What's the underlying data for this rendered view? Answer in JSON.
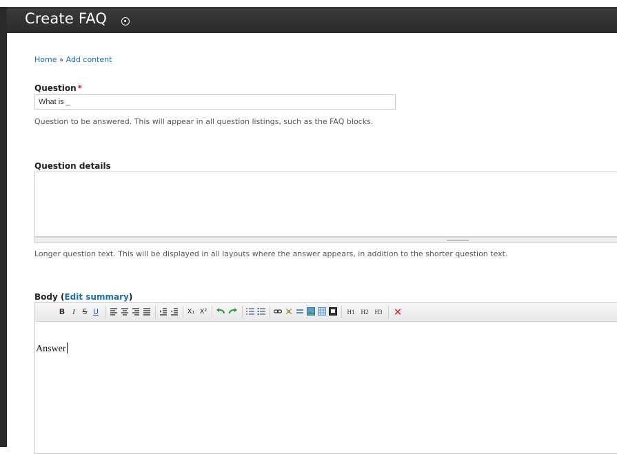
{
  "header": {
    "title": "Create FAQ",
    "icon": "circle-plus-icon"
  },
  "breadcrumb": {
    "home": "Home",
    "separator": "»",
    "current": "Add content"
  },
  "question": {
    "label": "Question",
    "required_mark": "*",
    "value": "What is _",
    "description": "Question to be answered. This will appear in all question listings, such as the FAQ blocks."
  },
  "question_details": {
    "label": "Question details",
    "value": "",
    "description": "Longer question text. This will be displayed in all layouts where the answer appears, in addition to the shorter question text."
  },
  "body": {
    "label": "Body",
    "edit_summary": "Edit summary",
    "content": "Answer",
    "toolbar": {
      "bold": "B",
      "italic": "I",
      "strike": "S",
      "underline": "U",
      "subscript": "X₁",
      "superscript": "X²",
      "h1": "H1",
      "h2": "H2",
      "h3": "H3",
      "remove_format": "✕"
    }
  }
}
